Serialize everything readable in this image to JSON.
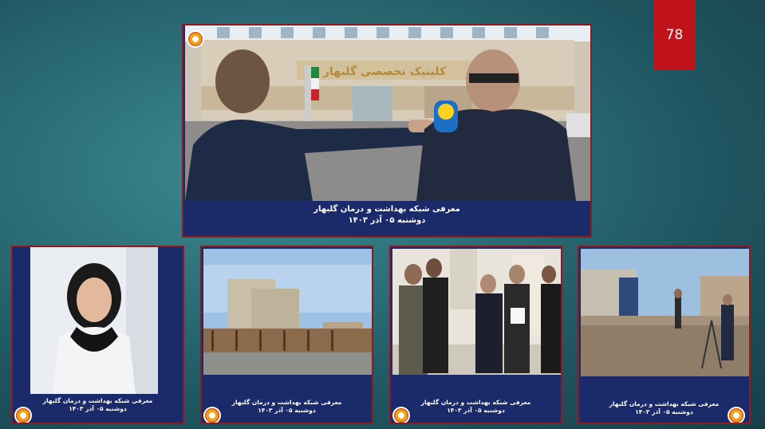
{
  "page": {
    "number": "78"
  },
  "main_card": {
    "title": "معرفی شبکه بهداشت و درمان گلبهار",
    "date": "دوشنبه ۰۵ آذر ۱۴۰۳",
    "building_sign": "کلینیک تخصصی گلبهار"
  },
  "thumbnails": [
    {
      "title": "معرفی شبکه بهداشت و درمان گلبهار",
      "date": "دوشنبه ۰۵ آذر ۱۴۰۳"
    },
    {
      "title": "معرفی شبکه بهداشت و درمان گلبهار",
      "date": "دوشنبه ۰۵ آذر ۱۴۰۳"
    },
    {
      "title": "معرفی شبکه بهداشت و درمان گلبهار",
      "date": "دوشنبه ۰۵ آذر ۱۴۰۳"
    },
    {
      "title": "معرفی شبکه بهداشت و درمان گلبهار",
      "date": "دوشنبه ۰۵ آذر ۱۴۰۳"
    }
  ],
  "colors": {
    "card_bg": "#1b2a6a",
    "card_border": "#8d1c22",
    "page_badge": "#c0131a"
  },
  "icons": [
    "network-logo-icon"
  ]
}
